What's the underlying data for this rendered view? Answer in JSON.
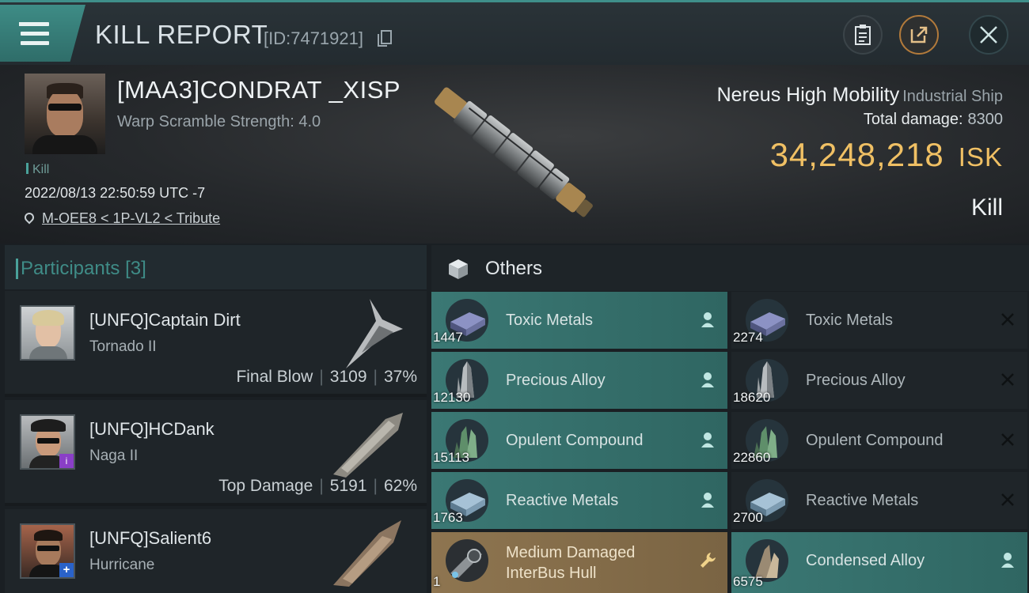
{
  "header": {
    "title": "KILL REPORT",
    "report_id": "[ID:7471921]",
    "pilot_name": "[MAA3]CONDRAT _XISP",
    "warp_scramble": "Warp Scramble Strength: 4.0",
    "kill_tag": "Kill",
    "datetime": "2022/08/13 22:50:59 UTC -7",
    "location": "M-OEE8 < 1P-VL2 < Tribute",
    "ship_name": "Nereus High Mobility",
    "ship_class": "Industrial Ship",
    "total_damage_label": "Total damage:",
    "total_damage": "8300",
    "isk_value": "34,248,218",
    "isk_unit": "ISK",
    "result": "Kill"
  },
  "participants": {
    "label": "Participants",
    "count": "[3]",
    "rows": [
      {
        "name": "[UNFQ]Captain Dirt",
        "ship": "Tornado II",
        "role": "Final Blow",
        "damage": "3109",
        "percent": "37%"
      },
      {
        "name": "[UNFQ]HCDank",
        "ship": "Naga II",
        "role": "Top Damage",
        "damage": "5191",
        "percent": "62%"
      },
      {
        "name": "[UNFQ]Salient6",
        "ship": "Hurricane",
        "role": "",
        "damage": "",
        "percent": ""
      }
    ]
  },
  "others": {
    "label": "Others",
    "left": [
      {
        "name": "Toxic Metals",
        "qty": "1447",
        "status": "person-icon"
      },
      {
        "name": "Precious Alloy",
        "qty": "12130",
        "status": "person-icon"
      },
      {
        "name": "Opulent Compound",
        "qty": "15113",
        "status": "person-icon"
      },
      {
        "name": "Reactive Metals",
        "qty": "1763",
        "status": "person-icon"
      },
      {
        "name_line1": "Medium Damaged",
        "name_line2": "InterBus Hull",
        "qty": "1",
        "status": "wrench-icon"
      }
    ],
    "right": [
      {
        "name": "Toxic Metals",
        "qty": "2274",
        "status": "close-icon"
      },
      {
        "name": "Precious Alloy",
        "qty": "18620",
        "status": "close-icon"
      },
      {
        "name": "Opulent Compound",
        "qty": "22860",
        "status": "close-icon"
      },
      {
        "name": "Reactive Metals",
        "qty": "2700",
        "status": "close-icon"
      },
      {
        "name": "Condensed Alloy",
        "qty": "6575",
        "status": "person-icon"
      }
    ]
  },
  "colors": {
    "accent_teal": "#3f8c87",
    "isk_gold": "#f0c064",
    "destroyed_row": "#1f2529",
    "dropped_row": "#3b7874",
    "module_row": "#8e7550"
  }
}
